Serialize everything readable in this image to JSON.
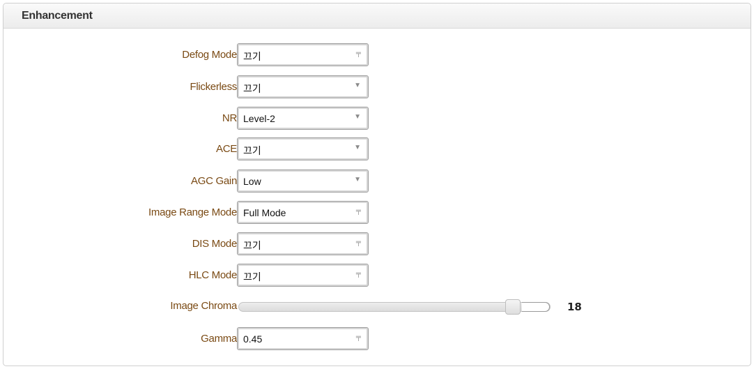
{
  "panel": {
    "title": "Enhancement"
  },
  "fields": {
    "defog_mode": {
      "label": "Defog Mode",
      "value": "끄기"
    },
    "flickerless": {
      "label": "Flickerless",
      "value": "끄기"
    },
    "nr": {
      "label": "NR",
      "value": "Level-2"
    },
    "ace": {
      "label": "ACE",
      "value": "끄기"
    },
    "agc_gain": {
      "label": "AGC Gain",
      "value": "Low"
    },
    "image_range_mode": {
      "label": "Image Range Mode",
      "value": "Full Mode"
    },
    "dis_mode": {
      "label": "DIS Mode",
      "value": "끄기"
    },
    "hlc_mode": {
      "label": "HLC Mode",
      "value": "끄기"
    },
    "image_chroma": {
      "label": "Image Chroma",
      "value": "18",
      "level_fraction": 0.9
    },
    "gamma": {
      "label": "Gamma",
      "value": "0.45"
    }
  },
  "icons": {
    "dropdown_arrow": "▼",
    "dropdown_arrow_alt": "╤"
  },
  "colors": {
    "label": "#7a4a14",
    "header_text": "#333333",
    "border": "#9e9e9e"
  }
}
